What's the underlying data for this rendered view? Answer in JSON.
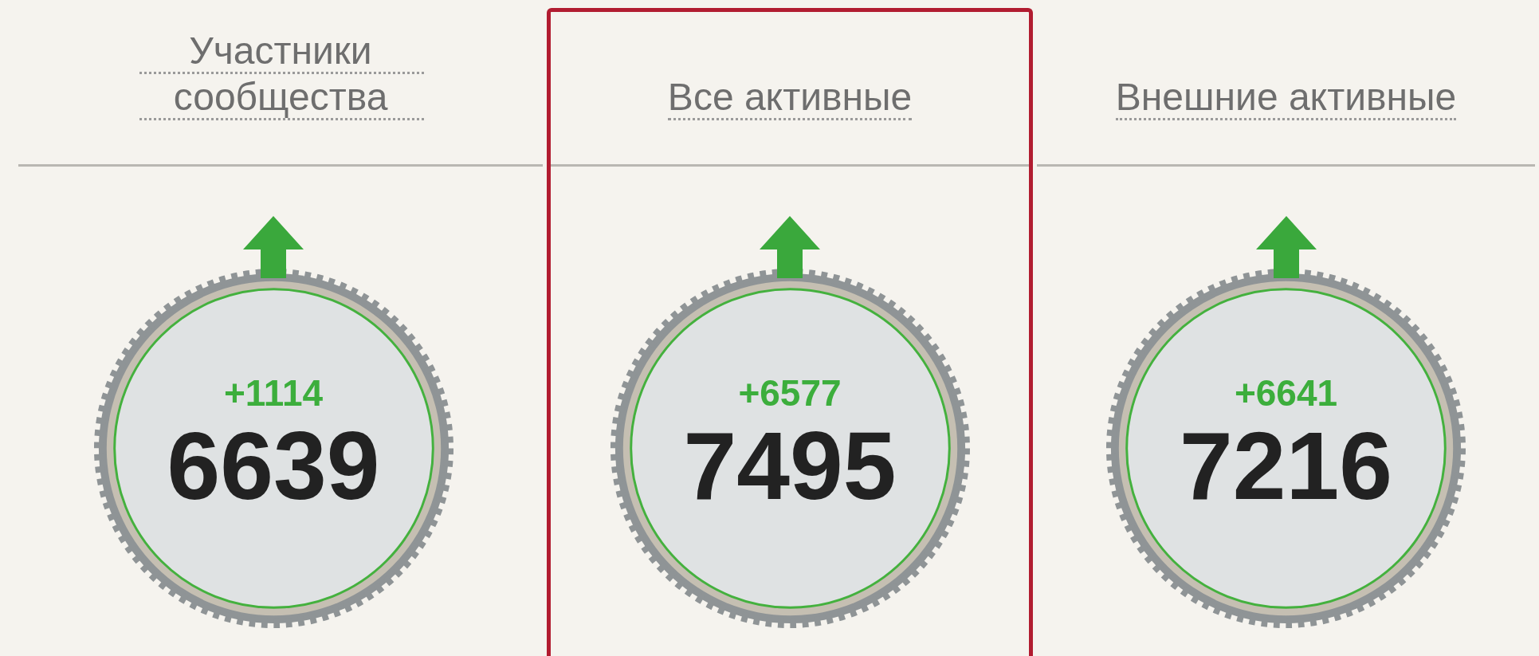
{
  "columns": [
    {
      "title": "Участники сообщества",
      "kind": "up",
      "delta": "+1114",
      "value": "6639",
      "selected": false
    },
    {
      "title": "Все активные",
      "kind": "up",
      "delta": "+6577",
      "value": "7495",
      "selected": true
    },
    {
      "title": "Внешние активные",
      "kind": "up",
      "delta": "+6641",
      "value": "7216",
      "selected": false
    }
  ]
}
